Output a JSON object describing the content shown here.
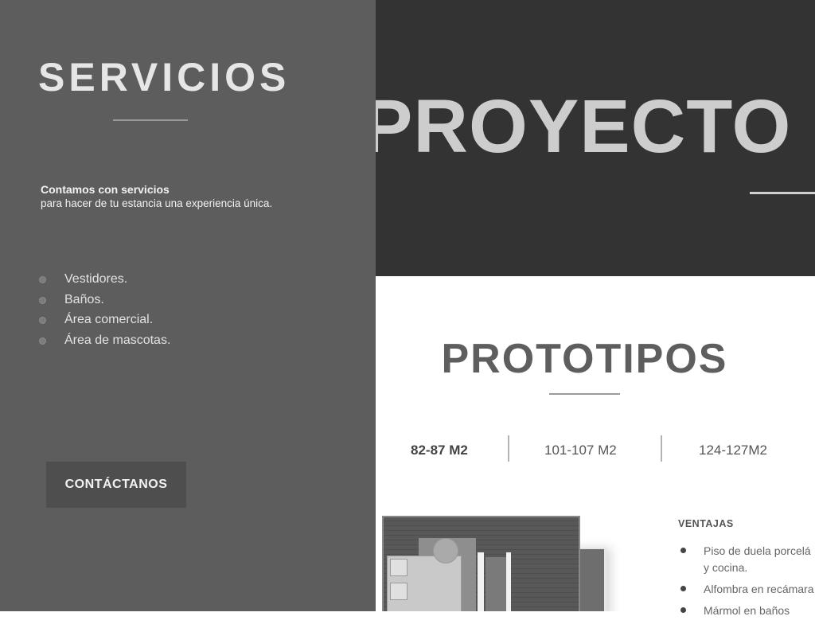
{
  "services": {
    "title": "SERVICIOS",
    "intro_strong": "Contamos con servicios",
    "intro_text": "para hacer de tu estancia una experiencia única.",
    "items": [
      "Vestidores.",
      "Baños.",
      "Área comercial.",
      "Área de mascotas."
    ],
    "contact_label": "CONTÁCTANOS"
  },
  "banner": {
    "title": "PROYECTO S"
  },
  "prototypes": {
    "title": "PROTOTIPOS",
    "tabs": [
      {
        "label": "82-87 M2",
        "active": true
      },
      {
        "label": "101-107 M2",
        "active": false
      },
      {
        "label": "124-127M2",
        "active": false
      }
    ],
    "advantages": {
      "title": "VENTAJAS",
      "items": [
        "Piso de duela porcelá",
        "y cocina.",
        "Alfombra en recámara",
        "Mármol en baños"
      ]
    }
  },
  "colors": {
    "left_panel": "#5d5d5d",
    "banner": "#333333",
    "button": "#4e4e4e"
  }
}
